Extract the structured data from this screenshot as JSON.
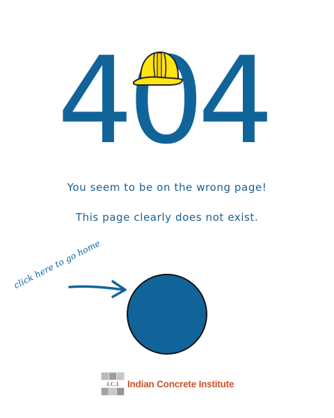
{
  "error": {
    "digit1": "4",
    "digit2": "0",
    "digit3": "4"
  },
  "messages": {
    "line1": "You seem to be on the wrong page!",
    "line2": "This page clearly does not exist."
  },
  "home_link": {
    "hint": "click here to go home"
  },
  "footer": {
    "logo_initials": "I.C.I",
    "org_name": "Indian Concrete Institute"
  },
  "colors": {
    "primary_blue": "#11649a",
    "hat_yellow": "#ffe414",
    "brand_orange": "#c8522a"
  },
  "icons": {
    "hat": "hard-hat-icon",
    "arrow": "arrow-right-icon"
  }
}
